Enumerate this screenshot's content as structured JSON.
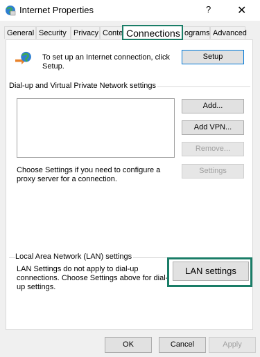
{
  "window": {
    "title": "Internet Properties",
    "help_label": "?",
    "close_label": "✕"
  },
  "tabs": [
    {
      "label": "General"
    },
    {
      "label": "Security"
    },
    {
      "label": "Privacy"
    },
    {
      "label": "Conten"
    },
    {
      "label": "Connections"
    },
    {
      "label": "ograms"
    },
    {
      "label": "Advanced"
    }
  ],
  "setup": {
    "text": "To set up an Internet connection, click Setup.",
    "button_label": "Setup"
  },
  "vpn": {
    "section_label": "Dial-up and Virtual Private Network settings",
    "add_label": "Add...",
    "add_vpn_label": "Add VPN...",
    "remove_label": "Remove...",
    "proxy_text": "Choose Settings if you need to configure a proxy server for a connection.",
    "settings_label": "Settings"
  },
  "lan": {
    "section_label": "Local Area Network (LAN) settings",
    "text": "LAN Settings do not apply to dial-up connections. Choose Settings above for dial-up settings.",
    "button_label": "LAN settings"
  },
  "footer": {
    "ok_label": "OK",
    "cancel_label": "Cancel",
    "apply_label": "Apply"
  }
}
